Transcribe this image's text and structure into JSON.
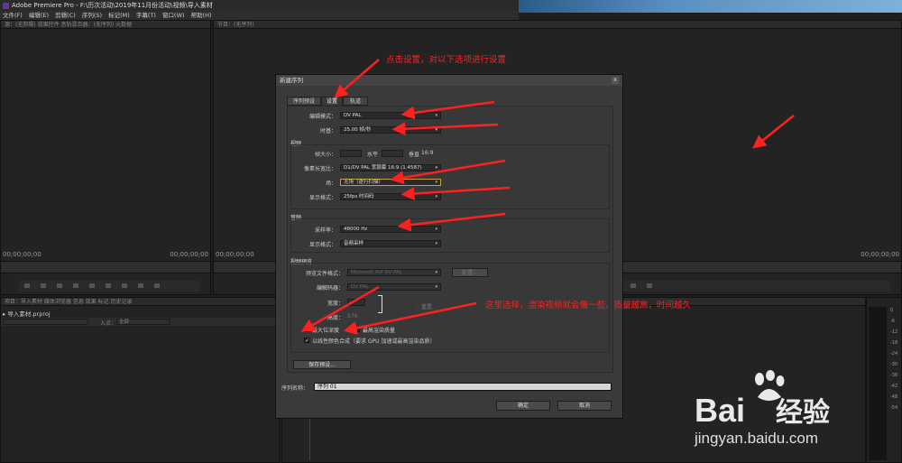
{
  "window": {
    "title": "Adobe Premiere Pro - F:\\历次活动\\2019年11月份活动\\视频\\导入素材"
  },
  "menu": [
    "文件(F)",
    "编辑(E)",
    "剪辑(C)",
    "序列(S)",
    "标记(M)",
    "字幕(T)",
    "窗口(W)",
    "帮助(H)"
  ],
  "source_panel": {
    "tabs": "源：(无剪辑)  效果控件  音轨混合器：(无序列)  元数据",
    "timecode_left": "00;00;00;00",
    "timecode_right": "00;00;00;00"
  },
  "program_panel": {
    "tab": "节目：(无序列)",
    "timecode_left": "00;00;00;00",
    "timecode_right": "00;00;00;00"
  },
  "project_panel": {
    "tabs": "项目：导入素材  媒体浏览器  信息  效果  标记  历史记录",
    "file": "导入素材.prproj",
    "in_label": "入点：",
    "in_value": "全部"
  },
  "dialog": {
    "title": "新建序列",
    "close": "x",
    "tabs": [
      "序列预设",
      "设置",
      "轨道"
    ],
    "editing_mode_label": "编辑模式：",
    "editing_mode": "DV PAL",
    "timebase_label": "时基：",
    "timebase": "25.00 帧/秒",
    "video_title": "视频",
    "frame_size_label": "帧大小：",
    "horizontal_label": "水平",
    "vertical_label": "垂直",
    "aspect": "16:9",
    "pixel_aspect_label": "像素长宽比：",
    "pixel_aspect": "D1/DV PAL 宽银幕 16:9 (1.4587)",
    "fields_label": "场：",
    "fields": "无场（逐行扫描）",
    "display_format_label": "显示格式：",
    "display_format": "25fps 时间码",
    "audio_title": "音频",
    "sample_rate_label": "采样率：",
    "sample_rate": "48000 Hz",
    "audio_display_label": "显示格式：",
    "audio_display": "音频采样",
    "preview_title": "视频预览",
    "preview_format_label": "预览文件格式：",
    "preview_format": "Microsoft AVI DV PAL",
    "configure": "配置...",
    "codec_label": "编解码器：",
    "codec": "DV PAL",
    "width_label": "宽度：",
    "height_label": "高度：",
    "height_value": "576",
    "reset": "重置",
    "max_bit_depth": "最大位深度",
    "max_render_quality": "最高渲染质量",
    "linear_color": "以线性颜色合成（要求 GPU 加速或最高渲染品质）",
    "save_preset": "保存预设...",
    "seq_name_label": "序列名称：",
    "seq_name": "序列 01",
    "ok": "确定",
    "cancel": "取消"
  },
  "annotations": {
    "top": "点击设置，对以下选项进行设置",
    "bottom": "这里选择，渲染视频就会慢一些，质量越高，时间越久"
  },
  "meter_ticks": [
    "0",
    "-6",
    "-12",
    "-18",
    "-24",
    "-30",
    "-36",
    "-42",
    "-48",
    "-54"
  ],
  "watermark": {
    "brand": "Bai",
    "brand2": "经验",
    "url": "jingyan.baidu.com"
  },
  "colors": {
    "annotation": "#ff2020",
    "premiere_purple": "#6b2fa0",
    "baidu_red": "#e0393e",
    "baidu_blue": "#2d3fd0"
  }
}
